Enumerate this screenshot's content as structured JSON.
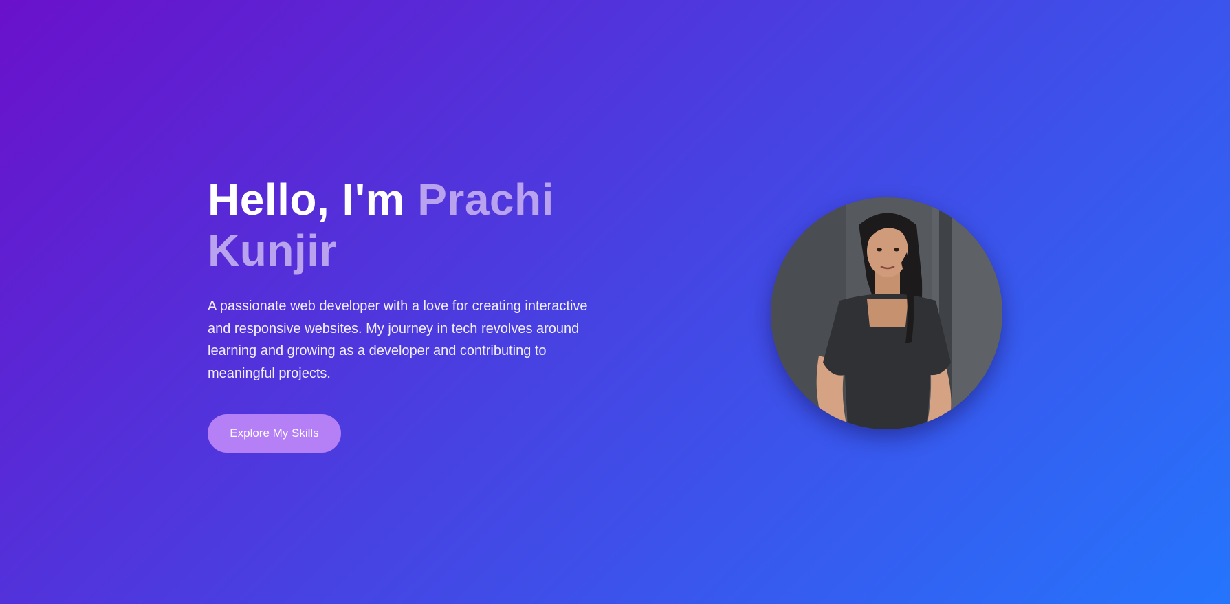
{
  "hero": {
    "greeting": "Hello, I'm",
    "name": "Prachi Kunjir",
    "description": "A passionate web developer with a love for creating interactive and responsive websites. My journey in tech revolves around learning and growing as a developer and contributing to meaningful projects.",
    "cta_label": "Explore My Skills"
  },
  "colors": {
    "gradient_start": "#6a11cb",
    "gradient_end": "#2575fc",
    "name_accent": "#b9a2ee",
    "button": "#b57ff6"
  },
  "avatar": {
    "icon": "profile-photo"
  }
}
